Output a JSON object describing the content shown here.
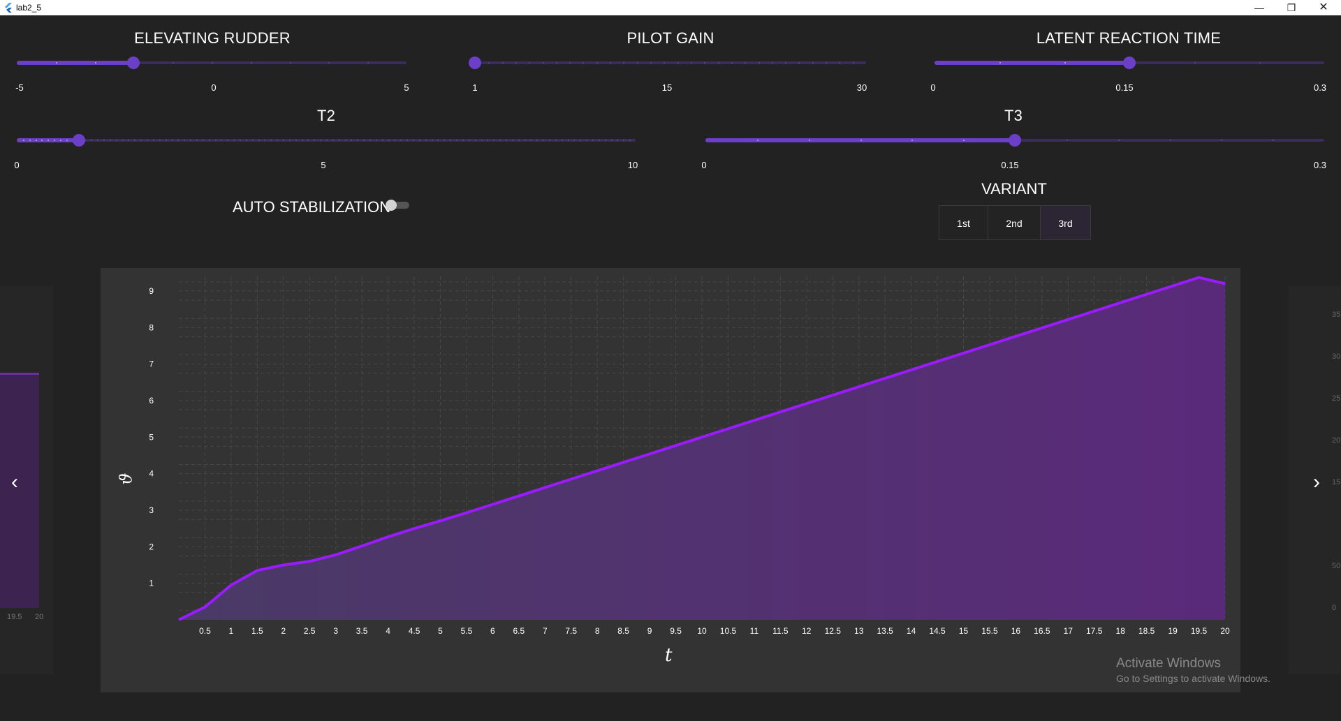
{
  "window": {
    "title": "lab2_5",
    "minimize_glyph": "—",
    "maximize_glyph": "❐",
    "close_glyph": "✕"
  },
  "sliders": [
    {
      "id": "elevating-rudder",
      "title": "ELEVATING RUDDER",
      "min": -5,
      "max": 5,
      "value": -2,
      "ticks": [
        "-5",
        "0",
        "5"
      ],
      "divisions": 10
    },
    {
      "id": "pilot-gain",
      "title": "PILOT GAIN",
      "min": 1,
      "max": 30,
      "value": 1,
      "ticks": [
        "1",
        "15",
        "30"
      ],
      "divisions": 29
    },
    {
      "id": "latent-reaction-time",
      "title": "LATENT REACTION TIME",
      "min": 0,
      "max": 0.3,
      "value": 0.15,
      "ticks": [
        "0",
        "0.15",
        "0.3"
      ],
      "divisions": 6
    },
    {
      "id": "t2",
      "title": "T2",
      "min": 0,
      "max": 10,
      "value": 1,
      "ticks": [
        "0",
        "5",
        "10"
      ],
      "divisions": 100
    },
    {
      "id": "t3",
      "title": "T3",
      "min": 0,
      "max": 0.3,
      "value": 0.15,
      "ticks": [
        "0",
        "0.15",
        "0.3"
      ],
      "divisions": 12
    }
  ],
  "auto_stabilization": {
    "label": "AUTO STABILIZATION",
    "checked": false
  },
  "variant": {
    "title": "VARIANT",
    "options": [
      "1st",
      "2nd",
      "3rd"
    ],
    "selected": "3rd"
  },
  "left_panel": {
    "tick_labels": [
      "19.5",
      "20"
    ]
  },
  "right_panel": {
    "tick_labels": [
      "35",
      "30",
      "25",
      "20",
      "15",
      "50",
      "0"
    ]
  },
  "nav": {
    "prev_glyph": "‹",
    "next_glyph": "›"
  },
  "chart_data": {
    "type": "area",
    "xlabel": "t",
    "ylabel": "ϑ",
    "xlim": [
      0,
      20
    ],
    "ylim": [
      0,
      9.4
    ],
    "x_ticks": [
      0.5,
      1,
      1.5,
      2,
      2.5,
      3,
      3.5,
      4,
      4.5,
      5,
      5.5,
      6,
      6.5,
      7,
      7.5,
      8,
      8.5,
      9,
      9.5,
      10,
      10.5,
      11,
      11.5,
      12,
      12.5,
      13,
      13.5,
      14,
      14.5,
      15,
      15.5,
      16,
      16.5,
      17,
      17.5,
      18,
      18.5,
      19,
      19.5,
      20
    ],
    "y_ticks": [
      1,
      2,
      3,
      4,
      5,
      6,
      7,
      8,
      9
    ],
    "grid": true,
    "x": [
      0,
      0.5,
      1,
      1.5,
      2,
      2.5,
      3,
      3.5,
      4,
      4.5,
      5,
      5.5,
      6,
      6.5,
      7,
      7.5,
      8,
      8.5,
      9,
      9.5,
      10,
      10.5,
      11,
      11.5,
      12,
      12.5,
      13,
      13.5,
      14,
      14.5,
      15,
      15.5,
      16,
      16.5,
      17,
      17.5,
      18,
      18.5,
      19,
      19.5,
      20
    ],
    "y": [
      0,
      0.35,
      0.95,
      1.35,
      1.5,
      1.6,
      1.78,
      2.02,
      2.27,
      2.5,
      2.71,
      2.93,
      3.16,
      3.39,
      3.62,
      3.85,
      4.08,
      4.31,
      4.54,
      4.77,
      5.0,
      5.23,
      5.46,
      5.69,
      5.92,
      6.15,
      6.38,
      6.61,
      6.84,
      7.07,
      7.3,
      7.53,
      7.76,
      7.99,
      8.22,
      8.45,
      8.68,
      8.91,
      9.14,
      9.37,
      9.2
    ],
    "line_color": "#9b1bff",
    "fill_color": "#5a2a7a"
  },
  "watermark": {
    "title": "Activate Windows",
    "subtitle": "Go to Settings to activate Windows."
  }
}
